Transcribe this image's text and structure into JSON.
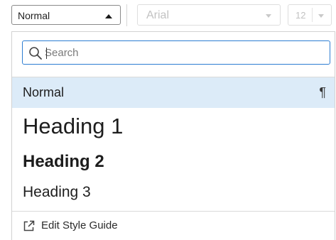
{
  "toolbar": {
    "style_value": "Normal",
    "font_value": "Arial",
    "size_value": "12"
  },
  "dropdown": {
    "search_placeholder": "Search",
    "items": [
      {
        "label": "Normal",
        "selected": true,
        "marker": "¶"
      },
      {
        "label": "Heading 1"
      },
      {
        "label": "Heading 2"
      },
      {
        "label": "Heading 3"
      }
    ],
    "footer_label": "Edit Style Guide"
  },
  "colors": {
    "selected_row_bg": "#dcebf8",
    "focus_border": "#2d7dd2",
    "disabled_text": "#c2c2c2"
  },
  "icons": {
    "search": "search-icon",
    "external": "external-link-icon",
    "style_caret": "caret-up-icon",
    "font_caret": "caret-down-icon",
    "size_caret": "caret-down-icon"
  }
}
